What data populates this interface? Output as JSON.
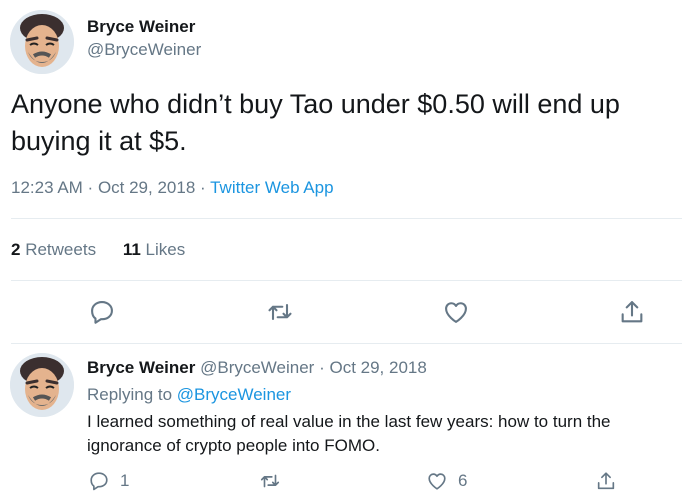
{
  "tweet": {
    "author_name": "Bryce Weiner",
    "author_handle": "@BryceWeiner",
    "text": "Anyone who didn’t buy Tao under $0.50 will end up buying it at $5.",
    "time": "12:23 AM",
    "separator": " · ",
    "date": "Oct 29, 2018",
    "source": "Twitter Web App",
    "retweets_count": "2",
    "retweets_label": "Retweets",
    "likes_count": "11",
    "likes_label": "Likes",
    "actions": [
      "reply-icon",
      "retweet-icon",
      "like-icon",
      "share-icon"
    ]
  },
  "reply": {
    "author_name": "Bryce Weiner",
    "author_handle": "@BryceWeiner",
    "separator": " · ",
    "date": "Oct 29, 2018",
    "replying_to_label": "Replying to ",
    "replying_to_handle": "@BryceWeiner",
    "text": "I learned something of real value in the last few years: how to turn the ignorance of crypto people into FOMO.",
    "reply_count": "1",
    "like_count": "6"
  },
  "colors": {
    "text": "#14171a",
    "muted": "#657786",
    "link": "#1b95e0",
    "divider": "#e6ecf0"
  }
}
